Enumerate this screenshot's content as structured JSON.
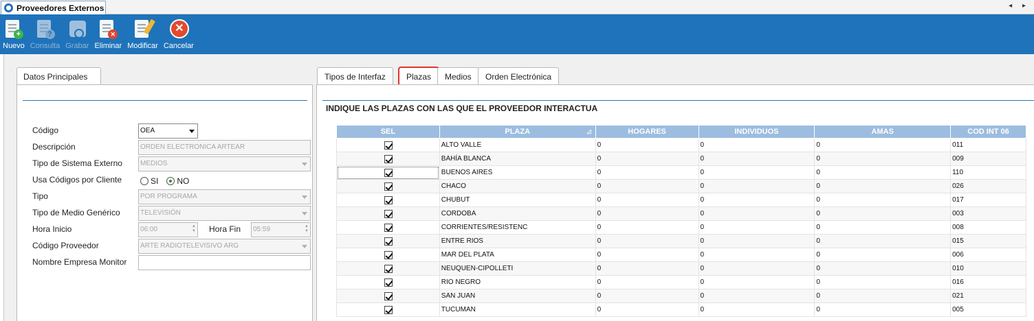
{
  "window": {
    "title": "Proveedores Externos"
  },
  "toolbar": {
    "buttons": [
      {
        "label": "Nuevo",
        "icon": "new-doc-icon",
        "enabled": true
      },
      {
        "label": "Consulta",
        "icon": "query-doc-icon",
        "enabled": false
      },
      {
        "label": "Grabar",
        "icon": "save-disk-icon",
        "enabled": false
      },
      {
        "label": "Eliminar",
        "icon": "delete-doc-icon",
        "enabled": true
      },
      {
        "label": "Modificar",
        "icon": "edit-doc-icon",
        "enabled": true
      },
      {
        "label": "Cancelar",
        "icon": "cancel-icon",
        "enabled": true
      }
    ]
  },
  "left": {
    "tab": "Datos Principales",
    "form": {
      "codigo_label": "Código",
      "codigo_value": "OEA",
      "descripcion_label": "Descripción",
      "descripcion_value": "ORDEN ELECTRONICA ARTEAR",
      "tipo_sistema_label": "Tipo de Sistema Externo",
      "tipo_sistema_value": "MEDIOS",
      "usa_codigos_label": "Usa Códigos por Cliente",
      "radio_si": "SI",
      "radio_no": "NO",
      "usa_codigos_selected": "NO",
      "tipo_label": "Tipo",
      "tipo_value": "POR PROGRAMA",
      "tipo_medio_label": "Tipo de Medio Genérico",
      "tipo_medio_value": "TELEVISIÓN",
      "hora_inicio_label": "Hora Inicio",
      "hora_inicio_value": "06:00",
      "hora_fin_label": "Hora Fin",
      "hora_fin_value": "05:59",
      "codigo_proveedor_label": "Código Proveedor",
      "codigo_proveedor_value": "ARTE RADIOTELEVISIVO ARG",
      "nombre_empresa_label": "Nombre Empresa Monitor",
      "nombre_empresa_value": ""
    }
  },
  "right": {
    "tabs": [
      "Tipos de Interfaz",
      "Plazas",
      "Medios",
      "Orden Electrónica"
    ],
    "active_tab": "Plazas",
    "heading": "INDIQUE LAS PLAZAS CON LAS QUE EL PROVEEDOR INTERACTUA",
    "columns": [
      "SEL",
      "PLAZA",
      "HOGARES",
      "INDIVIDUOS",
      "AMAS",
      "COD INT 06"
    ],
    "rows": [
      {
        "plaza": "ALTO VALLE",
        "hogares": "0",
        "individuos": "0",
        "amas": "0",
        "cod": "011"
      },
      {
        "plaza": "BAHÍA BLANCA",
        "hogares": "0",
        "individuos": "0",
        "amas": "0",
        "cod": "009"
      },
      {
        "plaza": "BUENOS AIRES",
        "hogares": "0",
        "individuos": "0",
        "amas": "0",
        "cod": "110"
      },
      {
        "plaza": "CHACO",
        "hogares": "0",
        "individuos": "0",
        "amas": "0",
        "cod": "026"
      },
      {
        "plaza": "CHUBUT",
        "hogares": "0",
        "individuos": "0",
        "amas": "0",
        "cod": "017"
      },
      {
        "plaza": "CORDOBA",
        "hogares": "0",
        "individuos": "0",
        "amas": "0",
        "cod": "003"
      },
      {
        "plaza": "CORRIENTES/RESISTENC",
        "hogares": "0",
        "individuos": "0",
        "amas": "0",
        "cod": "008"
      },
      {
        "plaza": "ENTRE RIOS",
        "hogares": "0",
        "individuos": "0",
        "amas": "0",
        "cod": "015"
      },
      {
        "plaza": "MAR DEL PLATA",
        "hogares": "0",
        "individuos": "0",
        "amas": "0",
        "cod": "006"
      },
      {
        "plaza": "NEUQUEN-CIPOLLETI",
        "hogares": "0",
        "individuos": "0",
        "amas": "0",
        "cod": "010"
      },
      {
        "plaza": "RIO NEGRO",
        "hogares": "0",
        "individuos": "0",
        "amas": "0",
        "cod": "016"
      },
      {
        "plaza": "SAN JUAN",
        "hogares": "0",
        "individuos": "0",
        "amas": "0",
        "cod": "021"
      },
      {
        "plaza": "TUCUMAN",
        "hogares": "0",
        "individuos": "0",
        "amas": "0",
        "cod": "005"
      }
    ]
  },
  "colors": {
    "toolbar": "#1f73ba",
    "header": "#9cbde0",
    "highlight": "#e0352b"
  }
}
